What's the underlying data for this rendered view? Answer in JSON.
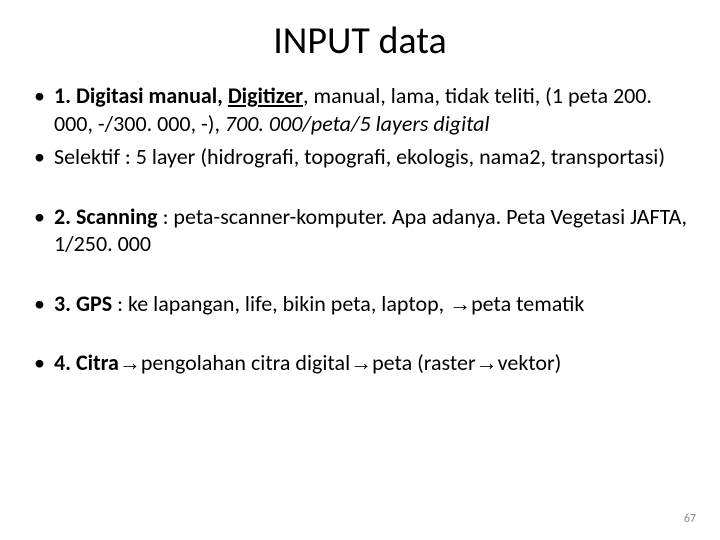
{
  "title": "INPUT data",
  "bullets": {
    "b1a_bold": "1. Digitasi manual, ",
    "b1a_underline": "Digitizer",
    "b1a_rest": ", manual, lama, tidak teliti, (1 peta 200. 000, -/300. 000, -), ",
    "b1a_italic": "700. 000/peta/5 layers digital",
    "b1b": "Selektif : 5 layer (hidrografi, topografi, ekologis, nama2, transportasi)",
    "b2_bold": "2. Scanning",
    "b2_rest": " : peta-scanner-komputer. Apa adanya. Peta Vegetasi JAFTA, 1/250. 000",
    "b3_bold": "3. GPS",
    "b3_rest_a": " : ke lapangan, life, bikin peta, laptop, ",
    "arrow": "→",
    "b3_rest_b": "peta tematik",
    "b4_bold": "4. Citra",
    "b4_rest_a": "pengolahan citra digital",
    "b4_rest_b": "peta (raster",
    "b4_rest_c": "vektor)"
  },
  "page_number": "67"
}
